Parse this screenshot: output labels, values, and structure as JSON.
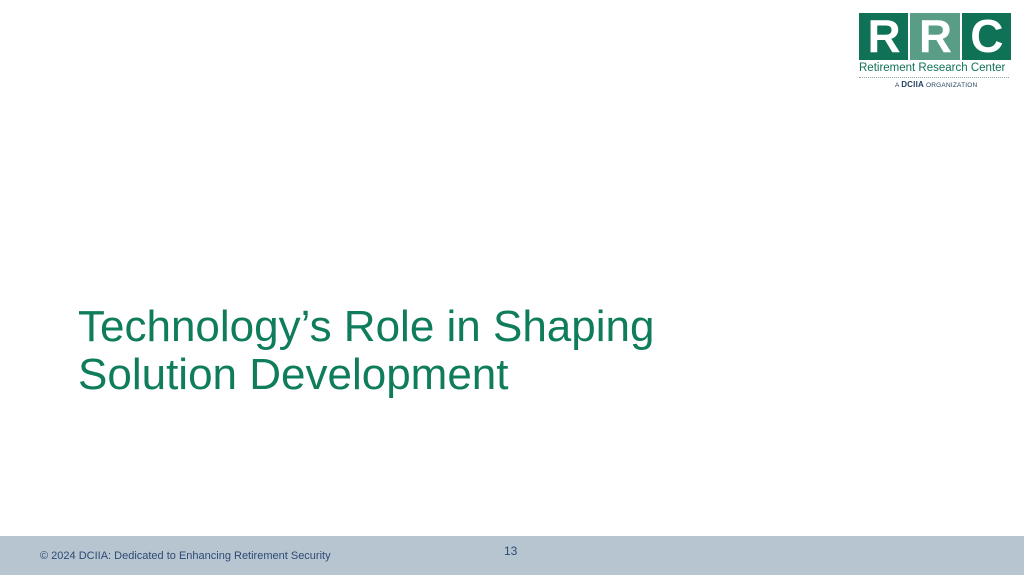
{
  "logo": {
    "letters": [
      "R",
      "R",
      "C"
    ],
    "name": "Retirement Research Center",
    "tagline_prefix": "A",
    "tagline_org": "DCIIA",
    "tagline_suffix": "ORGANIZATION",
    "colors": {
      "dark_green": "#0f7256",
      "light_green": "#5a9d86"
    }
  },
  "slide": {
    "title_line_1": "Technology’s Role in Shaping",
    "title_line_2": "Solution Development",
    "title_color": "#0f7c5c"
  },
  "footer": {
    "copyright": "© 2024 DCIIA: Dedicated to Enhancing Retirement Security",
    "page_number": "13",
    "background_color": "#b7c5d1",
    "text_color": "#2c4a73"
  }
}
